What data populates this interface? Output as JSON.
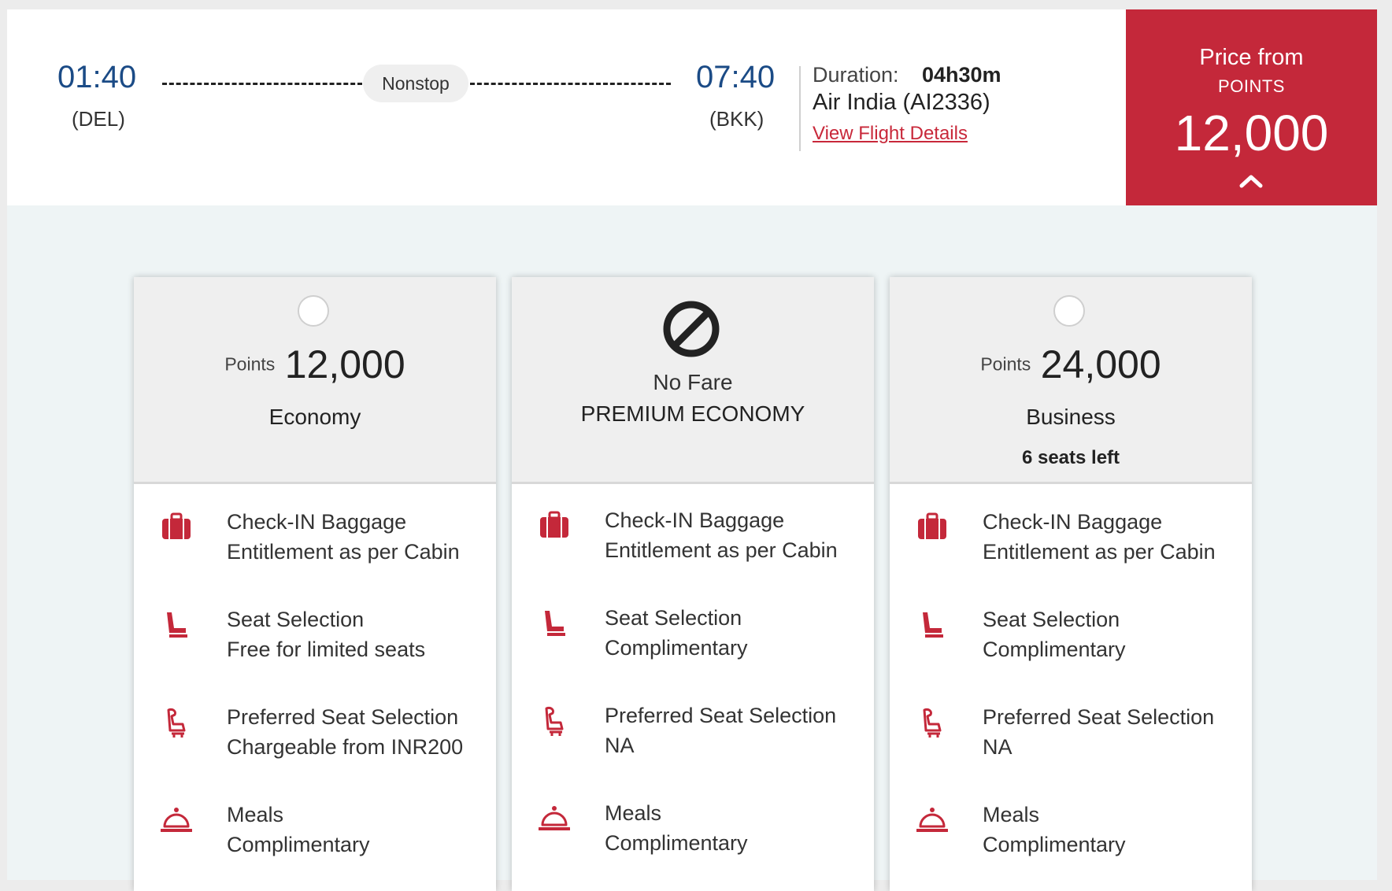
{
  "flight": {
    "departure_time": "01:40",
    "departure_code": "(DEL)",
    "arrival_time": "07:40",
    "arrival_code": "(BKK)",
    "stops": "Nonstop",
    "duration_label": "Duration:",
    "duration_value": "04h30m",
    "airline": "Air India (AI2336)",
    "details_link": "View Flight Details"
  },
  "price_box": {
    "title": "Price from",
    "unit": "POINTS",
    "value": "12,000",
    "chevron_icon": "chevron-up-icon"
  },
  "colors": {
    "accent": "#c4283a",
    "time_blue": "#1b4b86",
    "panel_bg": "#eef4f5"
  },
  "fares": [
    {
      "points_label": "Points",
      "points": "12,000",
      "cabin": "Economy",
      "features": [
        {
          "icon": "baggage-icon",
          "title": "Check-IN Baggage",
          "value": "Entitlement as per Cabin"
        },
        {
          "icon": "seat-icon",
          "title": "Seat Selection",
          "value": "Free for limited seats"
        },
        {
          "icon": "preferred-seat-icon",
          "title": "Preferred Seat Selection",
          "value": "Chargeable from INR200"
        },
        {
          "icon": "meal-icon",
          "title": "Meals",
          "value": "Complimentary"
        }
      ]
    },
    {
      "status": "No Fare",
      "status_icon": "no-fare-icon",
      "cabin": "PREMIUM ECONOMY",
      "features": [
        {
          "icon": "baggage-icon",
          "title": "Check-IN Baggage",
          "value": "Entitlement as per Cabin"
        },
        {
          "icon": "seat-icon",
          "title": "Seat Selection",
          "value": "Complimentary"
        },
        {
          "icon": "preferred-seat-icon",
          "title": "Preferred Seat Selection",
          "value": "NA"
        },
        {
          "icon": "meal-icon",
          "title": "Meals",
          "value": "Complimentary"
        }
      ]
    },
    {
      "points_label": "Points",
      "points": "24,000",
      "cabin": "Business",
      "seats_left": "6 seats left",
      "features": [
        {
          "icon": "baggage-icon",
          "title": "Check-IN Baggage",
          "value": "Entitlement as per Cabin"
        },
        {
          "icon": "seat-icon",
          "title": "Seat Selection",
          "value": "Complimentary"
        },
        {
          "icon": "preferred-seat-icon",
          "title": "Preferred Seat Selection",
          "value": "NA"
        },
        {
          "icon": "meal-icon",
          "title": "Meals",
          "value": "Complimentary"
        }
      ]
    }
  ]
}
